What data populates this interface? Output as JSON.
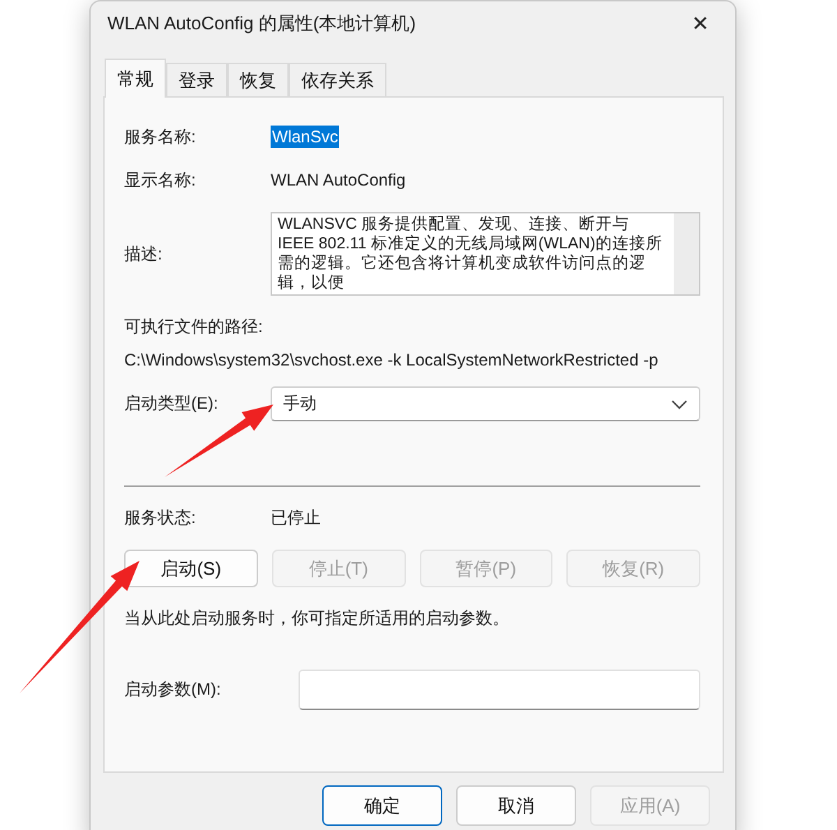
{
  "window": {
    "title": "WLAN AutoConfig 的属性(本地计算机)",
    "close": "✕"
  },
  "tabs": [
    {
      "label": "常规",
      "selected": true
    },
    {
      "label": "登录",
      "selected": false
    },
    {
      "label": "恢复",
      "selected": false
    },
    {
      "label": "依存关系",
      "selected": false
    }
  ],
  "service_name": {
    "label": "服务名称:",
    "value": "WlanSvc",
    "highlighted": true
  },
  "display_name": {
    "label": "显示名称:",
    "value": "WLAN AutoConfig"
  },
  "description": {
    "label": "描述:",
    "value": "WLANSVC 服务提供配置、发现、连接、断开与 IEEE 802.11 标准定义的无线局域网(WLAN)的连接所需的逻辑。它还包含将计算机变成软件访问点的逻辑，以便"
  },
  "executable_path": {
    "label": "可执行文件的路径:",
    "value": "C:\\Windows\\system32\\svchost.exe -k LocalSystemNetworkRestricted -p"
  },
  "startup_type": {
    "label": "启动类型(E):",
    "value": "手动"
  },
  "service_status": {
    "label": "服务状态:",
    "value": "已停止"
  },
  "control_buttons": [
    {
      "label": "启动(S)",
      "disabled": false
    },
    {
      "label": "停止(T)",
      "disabled": true
    },
    {
      "label": "暂停(P)",
      "disabled": true
    },
    {
      "label": "恢复(R)",
      "disabled": true
    }
  ],
  "hint": "当从此处启动服务时，你可指定所适用的启动参数。",
  "start_parameters": {
    "label": "启动参数(M):"
  },
  "dialog_buttons": [
    {
      "label": "确定",
      "default": true,
      "disabled": false
    },
    {
      "label": "取消",
      "default": false,
      "disabled": false
    },
    {
      "label": "应用(A)",
      "default": false,
      "disabled": true
    }
  ]
}
